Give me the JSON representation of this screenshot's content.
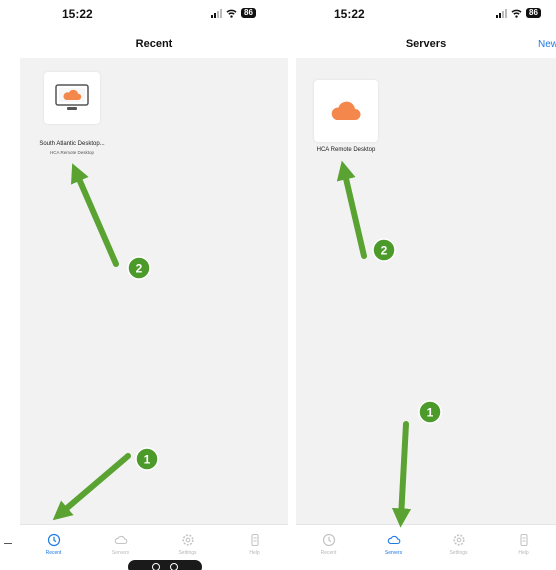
{
  "left_screen": {
    "status_time": "15:22",
    "battery": "86",
    "nav_title": "Recent",
    "tile": {
      "label": "South Atlantic Desktop...",
      "sublabel": "HCA Remote Desktop"
    },
    "tabs": [
      {
        "label": "Recent",
        "icon": "clock-icon",
        "active": true
      },
      {
        "label": "Servers",
        "icon": "cloud-icon",
        "active": false
      },
      {
        "label": "Settings",
        "icon": "gear-icon",
        "active": false
      },
      {
        "label": "Help",
        "icon": "help-icon",
        "active": false
      }
    ],
    "callouts": [
      {
        "number": "1",
        "target": "Recent tab"
      },
      {
        "number": "2",
        "target": "South Atlantic Desktop tile"
      }
    ]
  },
  "right_screen": {
    "status_time": "15:22",
    "battery": "86",
    "nav_title": "Servers",
    "nav_action": "New",
    "tile": {
      "label": "HCA Remote Desktop"
    },
    "tabs": [
      {
        "label": "Recent",
        "icon": "clock-icon",
        "active": false
      },
      {
        "label": "Servers",
        "icon": "cloud-icon",
        "active": true
      },
      {
        "label": "Settings",
        "icon": "gear-icon",
        "active": false
      },
      {
        "label": "Help",
        "icon": "help-icon",
        "active": false
      }
    ],
    "callouts": [
      {
        "number": "1",
        "target": "Servers tab"
      },
      {
        "number": "2",
        "target": "HCA Remote Desktop tile"
      }
    ]
  },
  "colors": {
    "arrow_green": "#5aa332",
    "badge_green": "#4c9a2a",
    "accent_blue": "#1e7ae6",
    "cloud_orange": "#f4874b",
    "screen_background": "#f2f2f2"
  }
}
